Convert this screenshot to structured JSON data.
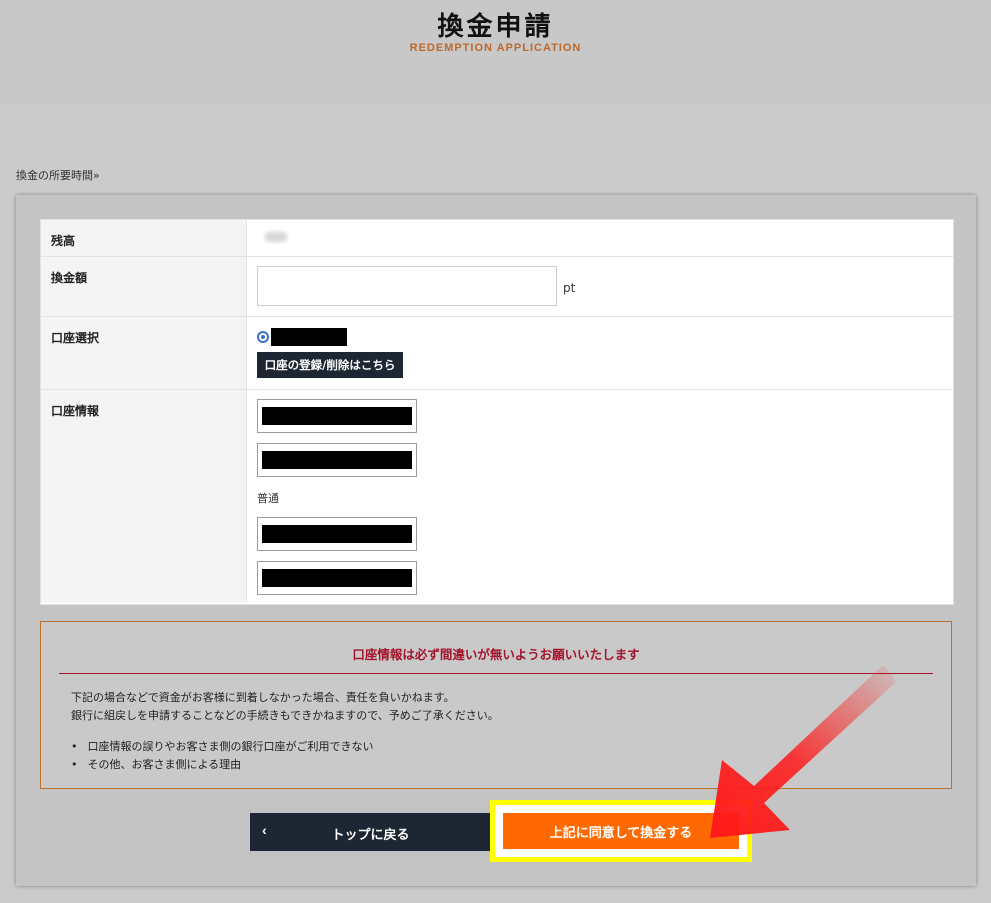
{
  "header": {
    "title": "換金申請",
    "subtitle": "REDEMPTION APPLICATION"
  },
  "time_link": "換金の所要時間»",
  "form": {
    "balance_label": "残高",
    "amount_label": "換金額",
    "amount_value": "",
    "amount_unit": "pt",
    "account_select_label": "口座選択",
    "account_register_button": "口座の登録/削除はこちら",
    "account_info_label": "口座情報",
    "account_type": "普通"
  },
  "notice": {
    "title": "口座情報は必ず間違いが無いようお願いいたします",
    "lines": [
      "下記の場合などで資金がお客様に到着しなかった場合、責任を負いかねます。",
      "銀行に組戻しを申請することなどの手続きもできかねますので、予めご了承ください。"
    ],
    "bullets": [
      "口座情報の誤りやお客さま側の銀行口座がご利用できない",
      "その他、お客さま側による理由"
    ]
  },
  "buttons": {
    "back_label": "トップに戻る",
    "back_chevron": "‹",
    "agree_label": "上記に同意して換金する"
  },
  "colors": {
    "accent": "#ff6a00",
    "navy": "#1c2733",
    "warning": "#a3152b",
    "highlight": "#ffff00",
    "arrow": "#ff1a1a"
  }
}
